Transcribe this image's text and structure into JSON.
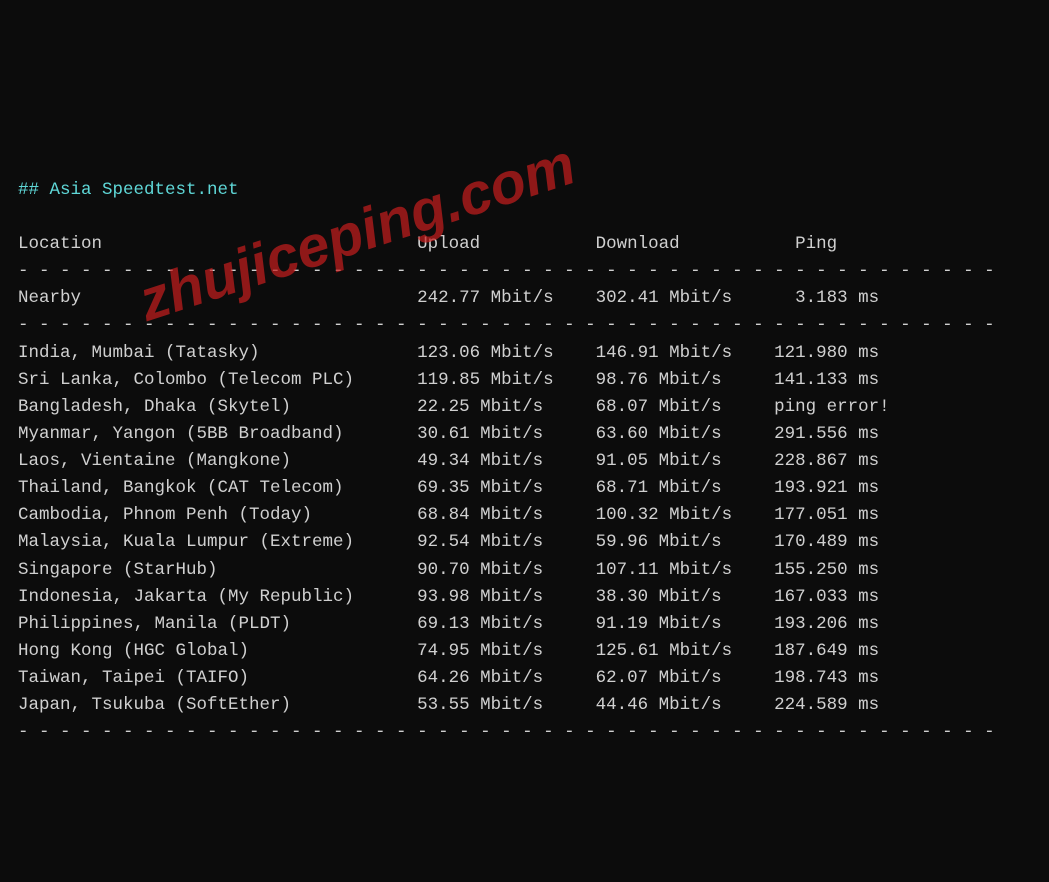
{
  "title_prefix": "## ",
  "title": "Asia Speedtest.net",
  "watermark": "zhujiceping.com",
  "headers": {
    "location": "Location",
    "upload": "Upload",
    "download": "Download",
    "ping": "Ping"
  },
  "nearby": {
    "location": "Nearby",
    "upload": "242.77 Mbit/s",
    "download": "302.41 Mbit/s",
    "ping": "3.183 ms"
  },
  "rows": [
    {
      "location": "India, Mumbai (Tatasky)",
      "upload": "123.06 Mbit/s",
      "download": "146.91 Mbit/s",
      "ping": "121.980 ms"
    },
    {
      "location": "Sri Lanka, Colombo (Telecom PLC)",
      "upload": "119.85 Mbit/s",
      "download": "98.76 Mbit/s",
      "ping": "141.133 ms"
    },
    {
      "location": "Bangladesh, Dhaka (Skytel)",
      "upload": "22.25 Mbit/s",
      "download": "68.07 Mbit/s",
      "ping": "ping error!"
    },
    {
      "location": "Myanmar, Yangon (5BB Broadband)",
      "upload": "30.61 Mbit/s",
      "download": "63.60 Mbit/s",
      "ping": "291.556 ms"
    },
    {
      "location": "Laos, Vientaine (Mangkone)",
      "upload": "49.34 Mbit/s",
      "download": "91.05 Mbit/s",
      "ping": "228.867 ms"
    },
    {
      "location": "Thailand, Bangkok (CAT Telecom)",
      "upload": "69.35 Mbit/s",
      "download": "68.71 Mbit/s",
      "ping": "193.921 ms"
    },
    {
      "location": "Cambodia, Phnom Penh (Today)",
      "upload": "68.84 Mbit/s",
      "download": "100.32 Mbit/s",
      "ping": "177.051 ms"
    },
    {
      "location": "Malaysia, Kuala Lumpur (Extreme)",
      "upload": "92.54 Mbit/s",
      "download": "59.96 Mbit/s",
      "ping": "170.489 ms"
    },
    {
      "location": "Singapore (StarHub)",
      "upload": "90.70 Mbit/s",
      "download": "107.11 Mbit/s",
      "ping": "155.250 ms"
    },
    {
      "location": "Indonesia, Jakarta (My Republic)",
      "upload": "93.98 Mbit/s",
      "download": "38.30 Mbit/s",
      "ping": "167.033 ms"
    },
    {
      "location": "Philippines, Manila (PLDT)",
      "upload": "69.13 Mbit/s",
      "download": "91.19 Mbit/s",
      "ping": "193.206 ms"
    },
    {
      "location": "Hong Kong (HGC Global)",
      "upload": "74.95 Mbit/s",
      "download": "125.61 Mbit/s",
      "ping": "187.649 ms"
    },
    {
      "location": "Taiwan, Taipei (TAIFO)",
      "upload": "64.26 Mbit/s",
      "download": "62.07 Mbit/s",
      "ping": "198.743 ms"
    },
    {
      "location": "Japan, Tsukuba (SoftEther)",
      "upload": "53.55 Mbit/s",
      "download": "44.46 Mbit/s",
      "ping": "224.589 ms"
    }
  ],
  "chart_data": {
    "type": "table",
    "title": "Asia Speedtest.net",
    "columns": [
      "Location",
      "Upload (Mbit/s)",
      "Download (Mbit/s)",
      "Ping (ms)"
    ],
    "nearby": {
      "location": "Nearby",
      "upload": 242.77,
      "download": 302.41,
      "ping": 3.183
    },
    "rows": [
      {
        "location": "India, Mumbai (Tatasky)",
        "upload": 123.06,
        "download": 146.91,
        "ping": 121.98
      },
      {
        "location": "Sri Lanka, Colombo (Telecom PLC)",
        "upload": 119.85,
        "download": 98.76,
        "ping": 141.133
      },
      {
        "location": "Bangladesh, Dhaka (Skytel)",
        "upload": 22.25,
        "download": 68.07,
        "ping": null
      },
      {
        "location": "Myanmar, Yangon (5BB Broadband)",
        "upload": 30.61,
        "download": 63.6,
        "ping": 291.556
      },
      {
        "location": "Laos, Vientaine (Mangkone)",
        "upload": 49.34,
        "download": 91.05,
        "ping": 228.867
      },
      {
        "location": "Thailand, Bangkok (CAT Telecom)",
        "upload": 69.35,
        "download": 68.71,
        "ping": 193.921
      },
      {
        "location": "Cambodia, Phnom Penh (Today)",
        "upload": 68.84,
        "download": 100.32,
        "ping": 177.051
      },
      {
        "location": "Malaysia, Kuala Lumpur (Extreme)",
        "upload": 92.54,
        "download": 59.96,
        "ping": 170.489
      },
      {
        "location": "Singapore (StarHub)",
        "upload": 90.7,
        "download": 107.11,
        "ping": 155.25
      },
      {
        "location": "Indonesia, Jakarta (My Republic)",
        "upload": 93.98,
        "download": 38.3,
        "ping": 167.033
      },
      {
        "location": "Philippines, Manila (PLDT)",
        "upload": 69.13,
        "download": 91.19,
        "ping": 193.206
      },
      {
        "location": "Hong Kong (HGC Global)",
        "upload": 74.95,
        "download": 125.61,
        "ping": 187.649
      },
      {
        "location": "Taiwan, Taipei (TAIFO)",
        "upload": 64.26,
        "download": 62.07,
        "ping": 198.743
      },
      {
        "location": "Japan, Tsukuba (SoftEther)",
        "upload": 53.55,
        "download": 44.46,
        "ping": 224.589
      }
    ]
  }
}
